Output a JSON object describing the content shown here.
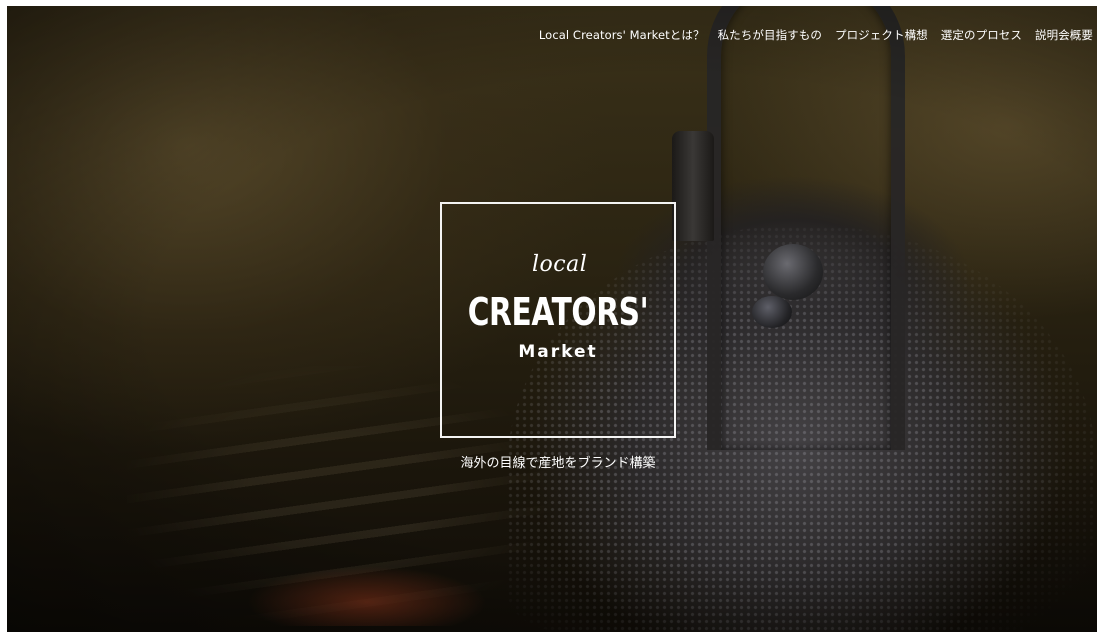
{
  "nav": {
    "items": [
      {
        "label": "Local Creators' Marketとは？"
      },
      {
        "label": "私たちが目指すもの"
      },
      {
        "label": "プロジェクト構想"
      },
      {
        "label": "選定のプロセス"
      },
      {
        "label": "説明会概要"
      }
    ]
  },
  "logo": {
    "local": "local",
    "creators": "CREATORS'",
    "market": "Market"
  },
  "hero": {
    "tagline": "海外の目線で産地をブランド構築"
  },
  "colors": {
    "text": "#ffffff",
    "background": "#1c170e"
  }
}
